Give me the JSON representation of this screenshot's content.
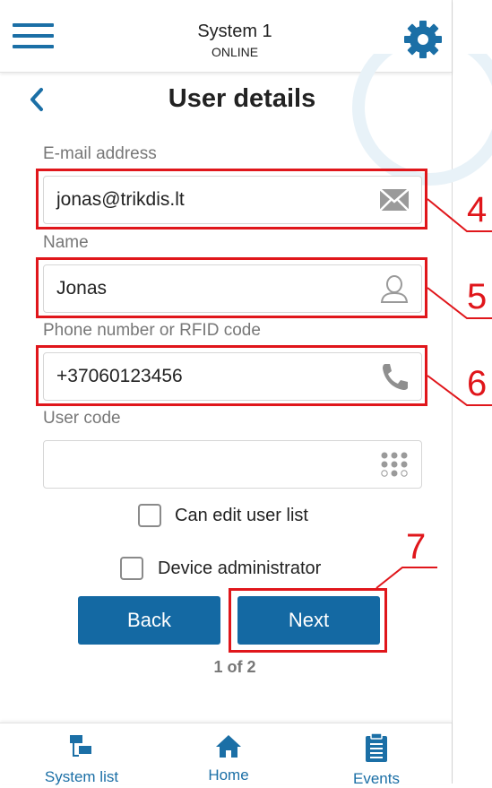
{
  "header": {
    "system_name": "System 1",
    "status": "ONLINE",
    "menu_icon": "hamburger-menu-icon",
    "settings_icon": "gear-icon"
  },
  "page": {
    "title": "User details",
    "back_icon": "chevron-left-icon"
  },
  "form": {
    "email": {
      "label": "E-mail address",
      "value": "jonas@trikdis.lt",
      "icon": "envelope-icon"
    },
    "name": {
      "label": "Name",
      "value": "Jonas",
      "icon": "user-icon"
    },
    "phone": {
      "label": "Phone number or RFID code",
      "value": "+37060123456",
      "icon": "phone-icon"
    },
    "user_code": {
      "label": "User code",
      "value": "",
      "icon": "keypad-icon"
    },
    "can_edit_label": "Can edit user list",
    "can_edit_checked": false,
    "admin_label": "Device administrator",
    "admin_checked": false
  },
  "buttons": {
    "back": "Back",
    "next": "Next"
  },
  "pager": "1 of 2",
  "bottom_nav": [
    {
      "label": "System list",
      "icon": "system-list-icon"
    },
    {
      "label": "Home",
      "icon": "home-icon"
    },
    {
      "label": "Events",
      "icon": "clipboard-icon"
    }
  ],
  "annotations": {
    "callout_4": "4",
    "callout_5": "5",
    "callout_6": "6",
    "callout_7": "7",
    "highlight_color": "#e0161b"
  },
  "colors": {
    "accent": "#1469a3",
    "label_gray": "#777777"
  }
}
